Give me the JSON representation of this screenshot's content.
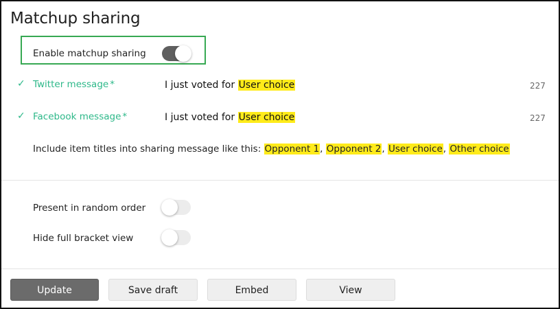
{
  "section": {
    "title": "Matchup sharing"
  },
  "sharing_toggle": {
    "label": "Enable matchup sharing",
    "state": "on"
  },
  "twitter": {
    "label": "Twitter message",
    "required_mark": "*",
    "message_prefix": "I just voted for ",
    "message_token": "User choice",
    "count": "227"
  },
  "facebook": {
    "label": "Facebook message",
    "required_mark": "*",
    "message_prefix": "I just voted for ",
    "message_token": "User choice",
    "count": "227"
  },
  "include": {
    "text": "Include item titles into sharing message like this: ",
    "tokens": [
      "Opponent 1",
      "Opponent 2",
      "User choice",
      "Other choice"
    ],
    "separator": ", "
  },
  "options": {
    "random_order": {
      "label": "Present in random order",
      "state": "off"
    },
    "hide_bracket": {
      "label": "Hide full bracket view",
      "state": "off"
    }
  },
  "buttons": {
    "update": "Update",
    "save_draft": "Save draft",
    "embed": "Embed",
    "view": "View"
  },
  "colors": {
    "accent_green": "#2db889",
    "highlight_yellow": "#ffeb1a",
    "focus_box_green": "#36a852",
    "primary_button": "#6b6b6b"
  },
  "icons": {
    "valid": "check-icon"
  }
}
